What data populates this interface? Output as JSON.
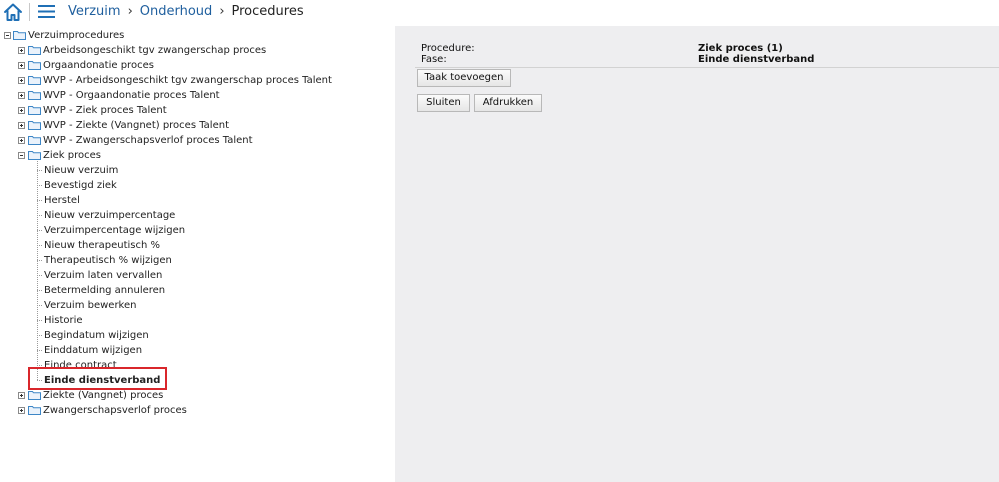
{
  "breadcrumb": {
    "items": [
      "Verzuim",
      "Onderhoud",
      "Procedures"
    ]
  },
  "tree": {
    "root": "Verzuimprocedures",
    "top_items": [
      "Arbeidsongeschikt tgv zwangerschap proces",
      "Orgaandonatie proces",
      "WVP - Arbeidsongeschikt tgv zwangerschap proces Talent",
      "WVP - Orgaandonatie proces Talent",
      "WVP - Ziek proces Talent",
      "WVP - Ziekte (Vangnet) proces Talent",
      "WVP - Zwangerschapsverlof proces Talent"
    ],
    "expanded": "Ziek proces",
    "children": [
      "Nieuw verzuim",
      "Bevestigd ziek",
      "Herstel",
      "Nieuw verzuimpercentage",
      "Verzuimpercentage wijzigen",
      "Nieuw therapeutisch %",
      "Therapeutisch % wijzigen",
      "Verzuim laten vervallen",
      "Betermelding annuleren",
      "Verzuim bewerken",
      "Historie",
      "Begindatum wijzigen",
      "Einddatum wijzigen",
      "Einde contract",
      "Einde dienstverband"
    ],
    "selected": "Einde dienstverband",
    "bottom_items": [
      "Ziekte (Vangnet) proces",
      "Zwangerschapsverlof proces"
    ]
  },
  "detail": {
    "procedure_label": "Procedure:",
    "procedure_value": "Ziek proces (1)",
    "fase_label": "Fase:",
    "fase_value": "Einde dienstverband"
  },
  "buttons": {
    "add_task": "Taak toevoegen",
    "close": "Sluiten",
    "print": "Afdrukken"
  },
  "colors": {
    "accent": "#1f5f9e",
    "highlight_border": "#d9262b",
    "panel_bg": "#eeeef0"
  }
}
